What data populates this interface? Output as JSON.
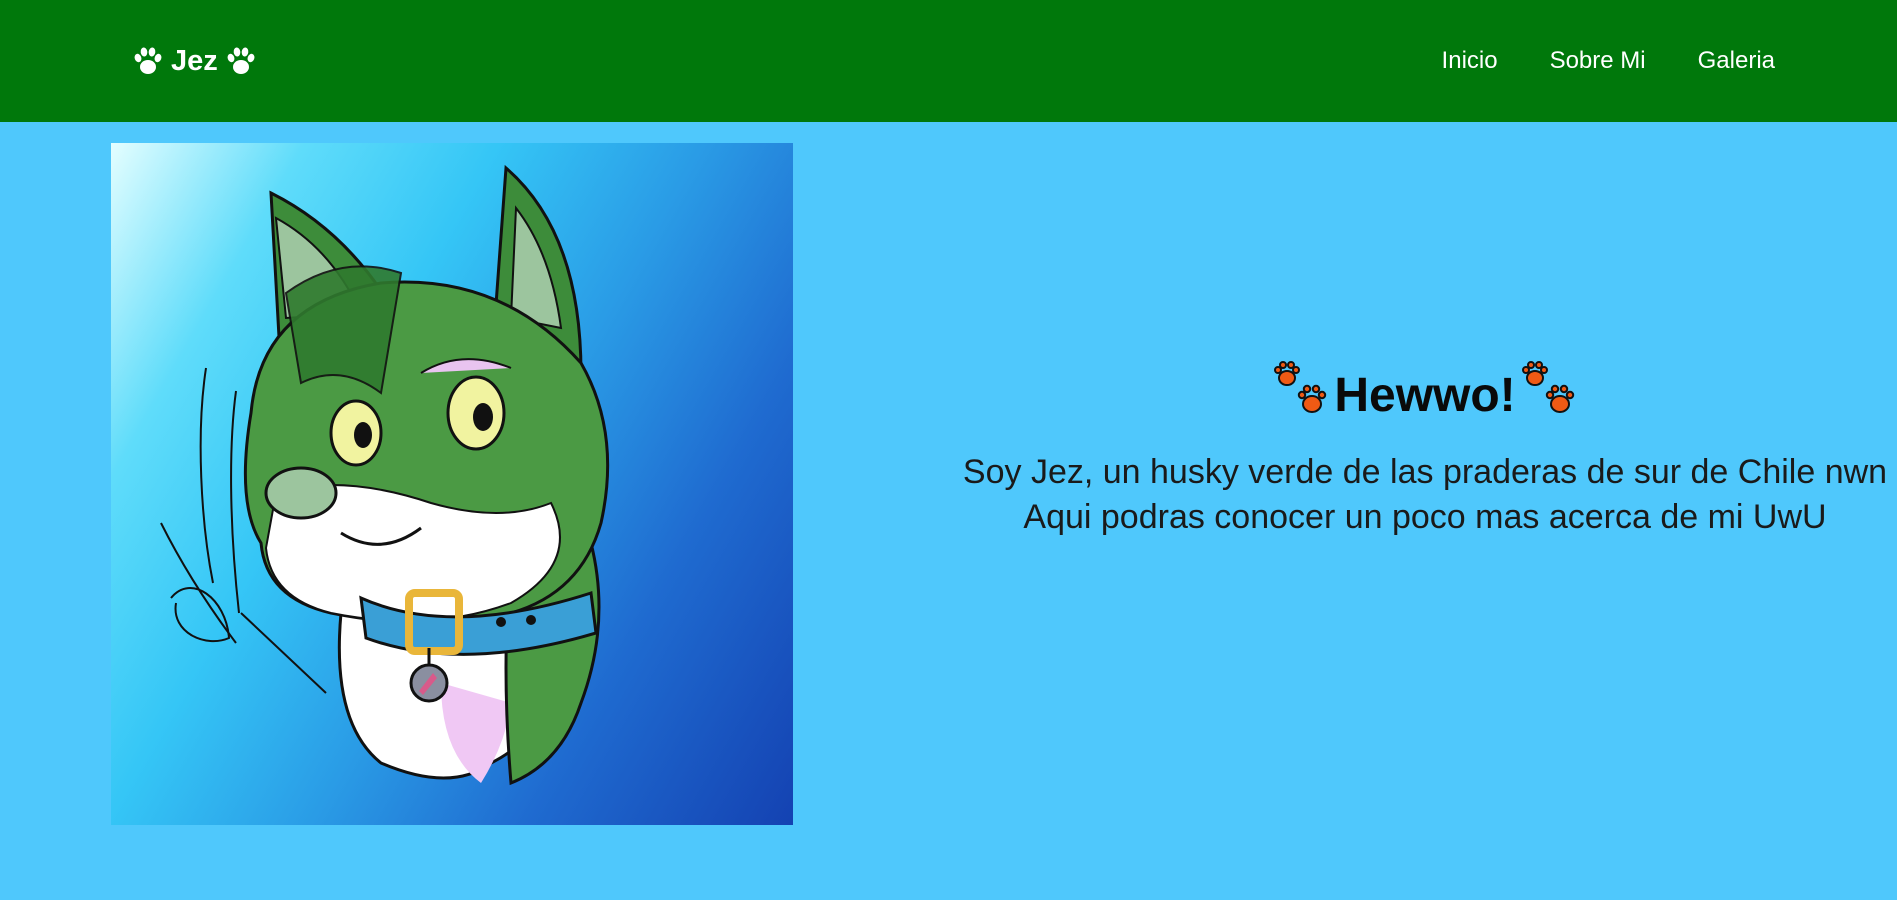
{
  "navbar": {
    "brand": "Jez",
    "brand_icon": "paw-icon",
    "links": [
      "Inicio",
      "Sobre Mi",
      "Galeria"
    ],
    "colors": {
      "background": "#00780b",
      "text": "#ffffff"
    }
  },
  "hero": {
    "image_description": "husky-portrait",
    "colors": {
      "page_background": "#4fc8fc"
    }
  },
  "intro": {
    "heading": "Hewwo!",
    "heading_icon": "paw-prints-icon",
    "heading_icon_color": "#f05a14",
    "line1": "Soy Jez, un husky verde de las praderas de sur de Chile nwn",
    "line2": "Aqui podras conocer un poco mas acerca de mi UwU"
  }
}
